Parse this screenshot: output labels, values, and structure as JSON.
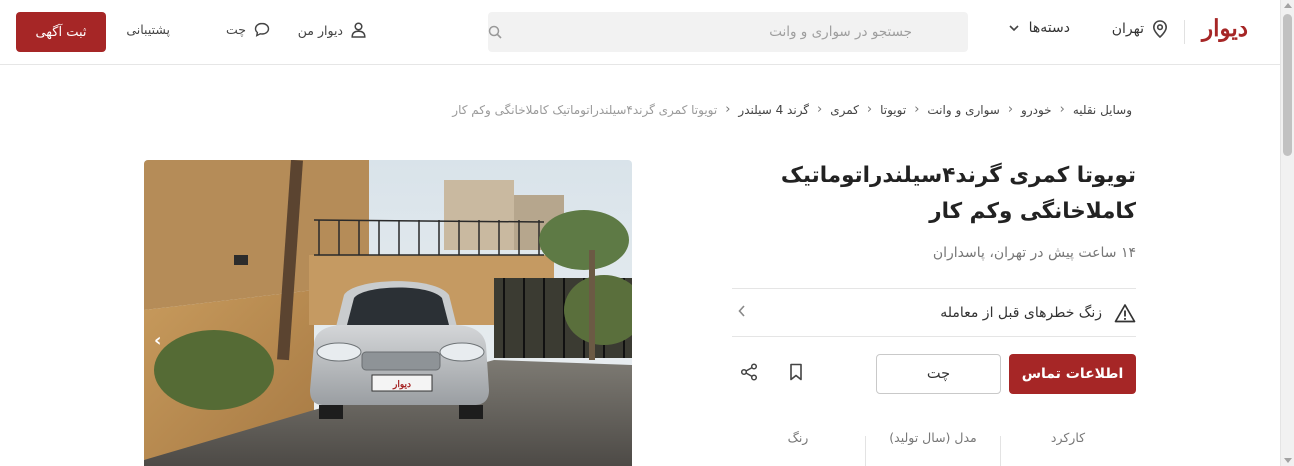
{
  "header": {
    "logo": "دیوار",
    "city": "تهران",
    "categories": "دسته‌ها",
    "search_placeholder": "جستجو در سواری و وانت",
    "my_divar": "دیوار من",
    "chat": "چت",
    "support": "پشتیبانی",
    "post_ad": "ثبت آگهی"
  },
  "breadcrumb": [
    "وسایل نقلیه",
    "خودرو",
    "سواری و وانت",
    "تویوتا",
    "کمری",
    "گرند 4 سیلندر",
    "تویوتا کمری گرند۴سیلندراتوماتیک کاملاخانگی وکم کار"
  ],
  "listing": {
    "title": "تویوتا کمری گرند۴سیلندراتوماتیک کاملاخانگی وکم کار",
    "subtitle": "۱۴ ساعت پیش در تهران، پاسداران",
    "warning": "زنگ خطرهای قبل از معامله",
    "contact_button": "اطلاعات تماس",
    "chat_button": "چت",
    "plate_text": "دیوار"
  },
  "specs": {
    "mileage_label": "کارکرد",
    "model_label": "مدل (سال تولید)",
    "color_label": "رنگ"
  },
  "colors": {
    "brand": "#a62626"
  },
  "icons": [
    "location-icon",
    "chevron-down-icon",
    "search-icon",
    "user-icon",
    "chat-bubble-icon",
    "warning-icon",
    "chevron-left-icon",
    "bookmark-icon",
    "share-icon"
  ]
}
